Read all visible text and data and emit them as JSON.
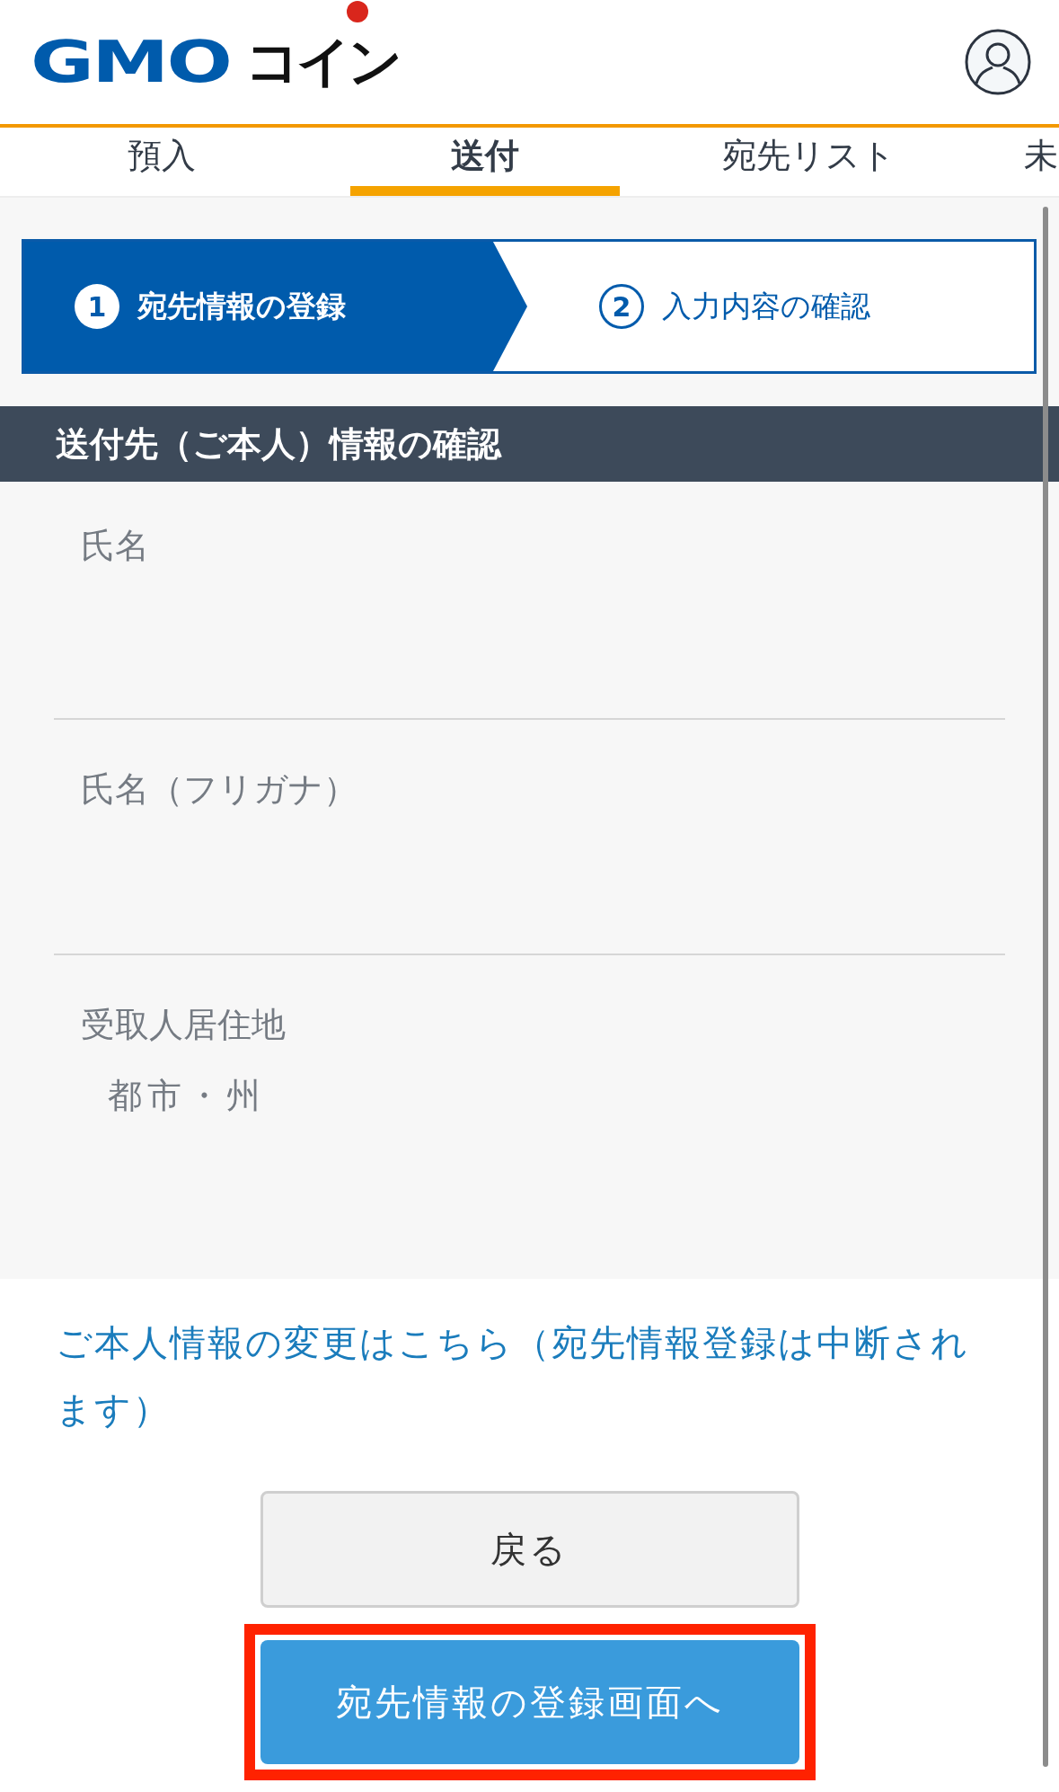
{
  "header": {
    "logo": {
      "latin": "GMO",
      "kana": "コイン"
    }
  },
  "tabs": [
    {
      "label": "預入",
      "selected": false
    },
    {
      "label": "送付",
      "selected": true
    },
    {
      "label": "宛先リスト",
      "selected": false
    },
    {
      "label": "未",
      "selected": false
    }
  ],
  "steps": [
    {
      "number": "1",
      "label": "宛先情報の登録",
      "selected": true
    },
    {
      "number": "2",
      "label": "入力内容の確認",
      "selected": false
    }
  ],
  "section": {
    "title": "送付先（ご本人）情報の確認",
    "fields": [
      {
        "label": "氏名",
        "kind": "line"
      },
      {
        "label": "氏名（フリガナ）",
        "kind": "line"
      },
      {
        "label": "受取人居住地",
        "kind": "group",
        "sub_labels": [
          "都市・州"
        ]
      }
    ]
  },
  "link": "ご本人情報の変更はこちら（宛先情報登録は中断されます）",
  "buttons": [
    {
      "label": "戻る",
      "kind": "secondary",
      "highlighted": false
    },
    {
      "label": "宛先情報の登録画面へ",
      "kind": "primary",
      "highlighted": true
    }
  ]
}
